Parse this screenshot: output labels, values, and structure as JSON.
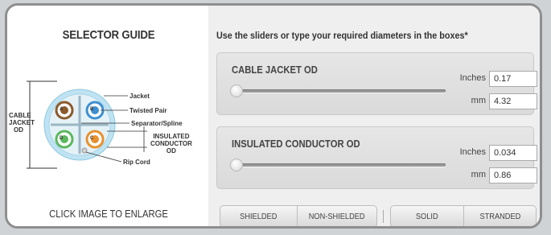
{
  "guide": {
    "title": "SELECTOR GUIDE",
    "enlarge_label": "CLICK IMAGE TO ENLARGE",
    "diagram": {
      "cable_jacket_od_label": [
        "CABLE",
        "JACKET",
        "OD"
      ],
      "insulated_conductor_od_label": [
        "INSULATED",
        "CONDUCTOR",
        "OD"
      ],
      "callouts": {
        "jacket": "Jacket",
        "twisted_pair": "Twisted Pair",
        "separator": "Separator/Spline",
        "rip_cord": "Rip Cord"
      },
      "pair_letters": [
        "A",
        "B",
        "C",
        "D"
      ]
    }
  },
  "selector": {
    "instructions": "Use the sliders or type your required diameters in the boxes*",
    "cable_jacket": {
      "title": "CABLE JACKET OD",
      "inches_label": "Inches",
      "inches_value": "0.17",
      "mm_label": "mm",
      "mm_value": "4.32",
      "slider_position": 0.0
    },
    "insulated_conductor": {
      "title": "INSULATED CONDUCTOR OD",
      "inches_label": "Inches",
      "inches_value": "0.034",
      "mm_label": "mm",
      "mm_value": "0.86",
      "slider_position": 0.0
    },
    "shield_options": [
      "SHIELDED",
      "NON-SHIELDED"
    ],
    "conductor_options": [
      "SOLID",
      "STRANDED"
    ]
  },
  "colors": {
    "frame_border": "#8e8e8e",
    "panel_bg": "#efefef",
    "jacket": "#bfe3f2",
    "pair_blue": "#3e8fd1",
    "pair_green": "#5cb85c",
    "pair_orange": "#e8912d",
    "pair_brown": "#8b5a2b"
  }
}
